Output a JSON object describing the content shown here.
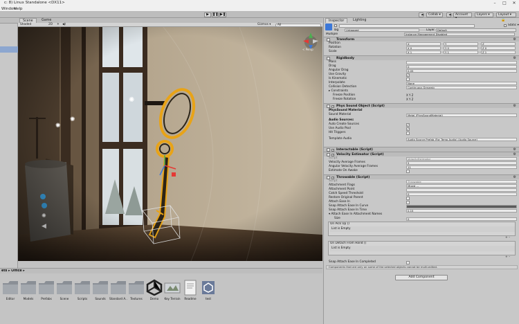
{
  "window": {
    "title": "c: 8) Linux Standalone <DX11>"
  },
  "menu": [
    "Window",
    "Help"
  ],
  "toolbar": {
    "play": "▶",
    "pause": "❚❚",
    "step": "▶❚",
    "collab": "Collab ▾",
    "account": "Account ▾",
    "layers": "Layers ▾",
    "layout": "Layout ▾"
  },
  "scene": {
    "tabs": [
      "Scene",
      "Game"
    ],
    "shading": "Shaded",
    "mode_2d": "2D",
    "gizmos": "Gizmos ▾",
    "search_placeholder": "All",
    "persp": "< Persp"
  },
  "project": {
    "title": "ets ▸ Office ▸",
    "assets": [
      "Editor",
      "Models",
      "Prefabs",
      "Scene",
      "Scripts",
      "Sounds",
      "Standard A...",
      "Textures",
      "Demo",
      "Key Terrain",
      "Readme",
      "test"
    ]
  },
  "inspector": {
    "tabs": [
      "Inspector",
      "Lighting"
    ],
    "static_label": "Static ▾",
    "tag_label": "Tag",
    "tag_value": "Untagged",
    "layer_label": "Layer",
    "layer_value": "Default",
    "multiple_label": "Multiple",
    "multiple_value": "Instance Management Disabled",
    "transform": {
      "title": "Transform",
      "rows": [
        {
          "label": "Position",
          "x": "X",
          "y": "Y",
          "z": "Z"
        },
        {
          "label": "Rotation",
          "x": "X 0",
          "y": "Y 0",
          "z": "Z 0"
        },
        {
          "label": "Scale",
          "x": "X 1",
          "y": "Y 1",
          "z": "Z 1"
        }
      ]
    },
    "rigidbody": {
      "title": "Rigidbody",
      "mass_label": "Mass",
      "mass_value": "",
      "drag_label": "Drag",
      "drag_value": "0",
      "angular_drag_label": "Angular Drag",
      "angular_drag_value": "0.05",
      "use_gravity_label": "Use Gravity",
      "is_kinematic_label": "Is Kinematic",
      "interpolate_label": "Interpolate",
      "interpolate_value": "None",
      "collision_label": "Collision Detection",
      "collision_value": "Continuous Dynamic",
      "constraints_label": "▸ Constraints",
      "freeze_pos_label": "Freeze Position",
      "freeze_rot_label": "Freeze Rotation",
      "xyz": "X  Y  Z"
    },
    "phys_sound": {
      "title": "Phys Sound Object (Script)",
      "material_heading": "PhysSound Material",
      "sound_material_label": "Sound Material",
      "sound_material_value": "Metal (PhysSoundMaterial)",
      "audio_heading": "Audio Sources:",
      "auto_create_label": "Auto Create Sources",
      "use_audio_pool_label": "Use Audio Pool",
      "hit_triggers_label": "Hit Triggers",
      "template_label": "Template Audio",
      "template_value": "Audio Source Prefab (For Temp Audio) (Audio Source)"
    },
    "interactable": {
      "title": "Interactable (Script)"
    },
    "velocity": {
      "title": "Velocity Estimator (Script)",
      "script_label": "Script",
      "script_value": "VelocityEstimator",
      "vel_frames_label": "Velocity Average Frames",
      "vel_frames_value": "5",
      "ang_frames_label": "Angular Velocity Average Frames",
      "ang_frames_value": "11",
      "estimate_awake_label": "Estimate On Awake"
    },
    "throwable": {
      "title": "Throwable (Script)",
      "script_label": "Script",
      "script_value": "Throwable",
      "attach_flags_label": "Attachment Flags",
      "attach_flags_value": "Mixed ...",
      "attach_point_label": "Attachment Point",
      "catch_speed_label": "Catch Speed Threshold",
      "catch_speed_value": "0",
      "restore_label": "Restore Original Parent",
      "attach_ease_label": "Attach Ease In",
      "snap_curve_label": "Snap Attach Ease In Curve",
      "snap_time_label": "Snap Attach Ease In Time",
      "snap_time_value": "0.15",
      "attach_names_label": "▾ Attach Ease In Attachment Names",
      "size_label": "Size",
      "size_value": "0",
      "on_pickup_label": "On Pick Up ()",
      "on_pickup_empty": "List is Empty",
      "on_detach_label": "On Detach From Hand ()",
      "on_detach_empty": "List is Empty",
      "snap_completed_label": "Snap Attach Ease In Completed",
      "plus_minus": "+ -"
    },
    "note": "Components that are only on some of the selected objects cannot be multi-edited.",
    "add_component": "Add Component"
  },
  "colors": {
    "selection": "#e8a317",
    "accent": "#3c78d8",
    "bg": "#c2c2c2"
  }
}
